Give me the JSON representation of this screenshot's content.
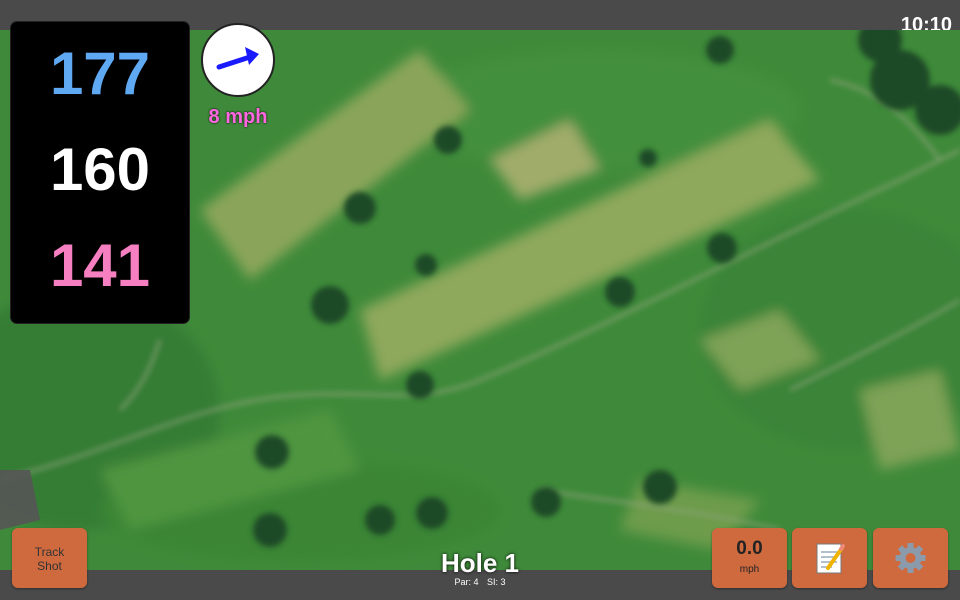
{
  "status": {
    "time": "10:10"
  },
  "distances": {
    "back": "177",
    "middle": "160",
    "front": "141",
    "colors": {
      "back": "#5fa8f2",
      "middle": "#ffffff",
      "front": "#f57fc0"
    }
  },
  "wind": {
    "speed": "8 mph",
    "icon": "wind-arrow-icon",
    "arrow_color": "#1a1aff",
    "speed_color": "#ff66e0"
  },
  "hole": {
    "title": "Hole 1",
    "par": "Par: 4",
    "si": "SI: 3"
  },
  "buttons": {
    "track_line1": "Track",
    "track_line2": "Shot",
    "speed_value": "0.0",
    "speed_unit": "mph",
    "notes_icon": "notepad-icon",
    "settings_icon": "gear-icon",
    "color": "#cf6a3f"
  }
}
